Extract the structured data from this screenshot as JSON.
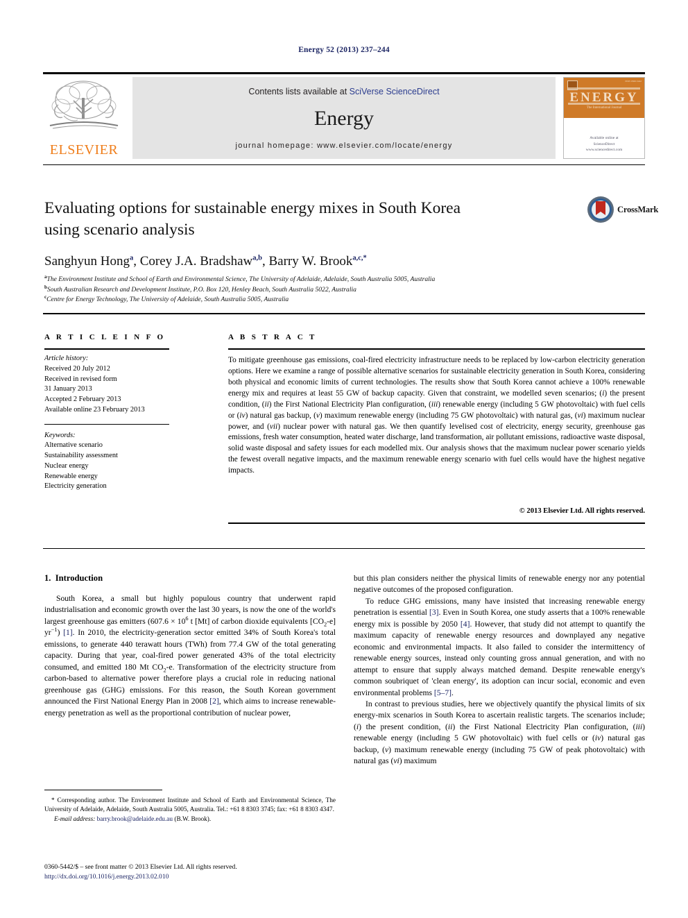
{
  "running_head": "Energy 52 (2013) 237–244",
  "masthead": {
    "contents_prefix": "Contents lists available at ",
    "sciencedirect": "SciVerse ScienceDirect",
    "journal_name": "Energy",
    "homepage": "journal homepage: www.elsevier.com/locate/energy",
    "publisher_logo_text": "ELSEVIER",
    "cover_title": "ENERGY",
    "cover_subtitle": "The International Journal",
    "cover_bottom_1": "Available online at",
    "cover_bottom_2": "ScienceDirect",
    "cover_bottom_3": "www.sciencedirect.com",
    "cover_code": "ISSN 0360-5442"
  },
  "crossmark": {
    "label": "CrossMark"
  },
  "article": {
    "title_line1": "Evaluating options for sustainable energy mixes in South Korea",
    "title_line2": "using scenario analysis",
    "authors": [
      {
        "name": "Sanghyun Hong",
        "marks": "a",
        "sep": ", "
      },
      {
        "name": "Corey J.A. Bradshaw",
        "marks": "a,b",
        "sep": ", "
      },
      {
        "name": "Barry W. Brook",
        "marks": "a,c,*",
        "sep": ""
      }
    ],
    "affiliations": [
      {
        "mark": "a",
        "text": "The Environment Institute and School of Earth and Environmental Science, The University of Adelaide, Adelaide, South Australia 5005, Australia"
      },
      {
        "mark": "b",
        "text": "South Australian Research and Development Institute, P.O. Box 120, Henley Beach, South Australia 5022, Australia"
      },
      {
        "mark": "c",
        "text": "Centre for Energy Technology, The University of Adelaide, South Australia 5005, Australia"
      }
    ]
  },
  "info": {
    "heading": "A R T I C L E  I N F O",
    "history_label": "Article history:",
    "history": [
      "Received 20 July 2012",
      "Received in revised form",
      "31 January 2013",
      "Accepted 2 February 2013",
      "Available online 23 February 2013"
    ],
    "keywords_label": "Keywords:",
    "keywords": [
      "Alternative scenario",
      "Sustainability assessment",
      "Nuclear energy",
      "Renewable energy",
      "Electricity generation"
    ]
  },
  "abstract": {
    "heading": "A B S T R A C T",
    "text_part1": "To mitigate greenhouse gas emissions, coal-fired electricity infrastructure needs to be replaced by low-carbon electricity generation options. Here we examine a range of possible alternative scenarios for sustainable electricity generation in South Korea, considering both physical and economic limits of current technologies. The results show that South Korea cannot achieve a 100% renewable energy mix and requires at least 55 GW of backup capacity. Given that constraint, we modelled seven scenarios; (",
    "i1": "i",
    "text_part2": ") the present condition, (",
    "i2": "ii",
    "text_part3": ") the First National Electricity Plan configuration, (",
    "i3": "iii",
    "text_part4": ") renewable energy (including 5 GW photovoltaic) with fuel cells or (",
    "i4": "iv",
    "text_part5": ") natural gas backup, (",
    "i5": "v",
    "text_part6": ") maximum renewable energy (including 75 GW photovoltaic) with natural gas, (",
    "i6": "vi",
    "text_part7": ") maximum nuclear power, and (",
    "i7": "vii",
    "text_part8": ") nuclear power with natural gas. We then quantify levelised cost of electricity, energy security, greenhouse gas emissions, fresh water consumption, heated water discharge, land transformation, air pollutant emissions, radioactive waste disposal, solid waste disposal and safety issues for each modelled mix. Our analysis shows that the maximum nuclear power scenario yields the fewest overall negative impacts, and the maximum renewable energy scenario with fuel cells would have the highest negative impacts.",
    "copyright": "© 2013 Elsevier Ltd. All rights reserved."
  },
  "body": {
    "section_number": "1.",
    "section_title": "Introduction",
    "left_p1_a": "South Korea, a small but highly populous country that underwent rapid industrialisation and economic growth over the last 30 years, is now the one of the world's largest greenhouse gas emitters (607.6 × 10",
    "left_p1_sup": "6",
    "left_p1_b": " t [Mt] of carbon dioxide equivalents [CO",
    "left_p1_sub": "2",
    "left_p1_c": "-e] yr",
    "left_p1_sup2": "−1",
    "left_p1_d": ") ",
    "ref1": "[1]",
    "left_p1_e": ". In 2010, the electricity-generation sector emitted 34% of South Korea's total emissions, to generate 440 terawatt hours (TWh) from 77.4 GW of the total generating capacity. During that year, coal-fired power generated 43% of the total electricity consumed, and emitted 180 Mt CO",
    "left_p1_sub2": "2",
    "left_p1_f": "-e. Transformation of the electricity structure from carbon-based to alternative power therefore plays a crucial role in reducing national greenhouse gas (GHG) emissions. For this reason, the South Korean government announced the First National Energy Plan in 2008 ",
    "ref2": "[2]",
    "left_p1_g": ", which aims to increase renewable-energy penetration as well as the proportional contribution of nuclear power,",
    "right_p1": "but this plan considers neither the physical limits of renewable energy nor any potential negative outcomes of the proposed configuration.",
    "right_p2_a": "To reduce GHG emissions, many have insisted that increasing renewable energy penetration is essential ",
    "ref3": "[3]",
    "right_p2_b": ". Even in South Korea, one study asserts that a 100% renewable energy mix is possible by 2050 ",
    "ref4": "[4]",
    "right_p2_c": ". However, that study did not attempt to quantify the maximum capacity of renewable energy resources and downplayed any negative economic and environmental impacts. It also failed to consider the intermittency of renewable energy sources, instead only counting gross annual generation, and with no attempt to ensure that supply always matched demand. Despite renewable energy's common soubriquet of 'clean energy', its adoption can incur social, economic and even environmental problems ",
    "ref57": "[5–7]",
    "right_p2_d": ".",
    "right_p3_a": "In contrast to previous studies, here we objectively quantify the physical limits of six energy-mix scenarios in South Korea to ascertain realistic targets. The scenarios include; (",
    "r_i1": "i",
    "right_p3_b": ") the present condition, (",
    "r_i2": "ii",
    "right_p3_c": ") the First National Electricity Plan configuration, (",
    "r_i3": "iii",
    "right_p3_d": ") renewable energy (including 5 GW photovoltaic) with fuel cells or (",
    "r_i4": "iv",
    "right_p3_e": ") natural gas backup, (",
    "r_i5": "v",
    "right_p3_f": ") maximum renewable energy (including 75 GW of peak photovoltaic) with natural gas (",
    "r_i6": "vi",
    "right_p3_g": ") maximum"
  },
  "footnotes": {
    "corresponding_mark": "*",
    "corresponding": " Corresponding author. The Environment Institute and School of Earth and Environmental Science, The University of Adelaide, Adelaide, South Australia 5005, Australia. Tel.: +61 8 8303 3745; fax: +61 8 8303 4347.",
    "email_label": "E-mail address:",
    "email": "barry.brook@adelaide.edu.au",
    "email_suffix": " (B.W. Brook).",
    "issn_line": "0360-5442/$ – see front matter © 2013 Elsevier Ltd. All rights reserved.",
    "doi": "http://dx.doi.org/10.1016/j.energy.2013.02.010"
  },
  "colors": {
    "elsevier_orange": "#ef7d1a",
    "link_navy": "#1b2463",
    "sciencedirect_blue": "#2b3c8e",
    "masthead_grey": "#e4e4e4",
    "cover_orange": "#cf7a28",
    "crossmark_red": "#c0281f"
  }
}
